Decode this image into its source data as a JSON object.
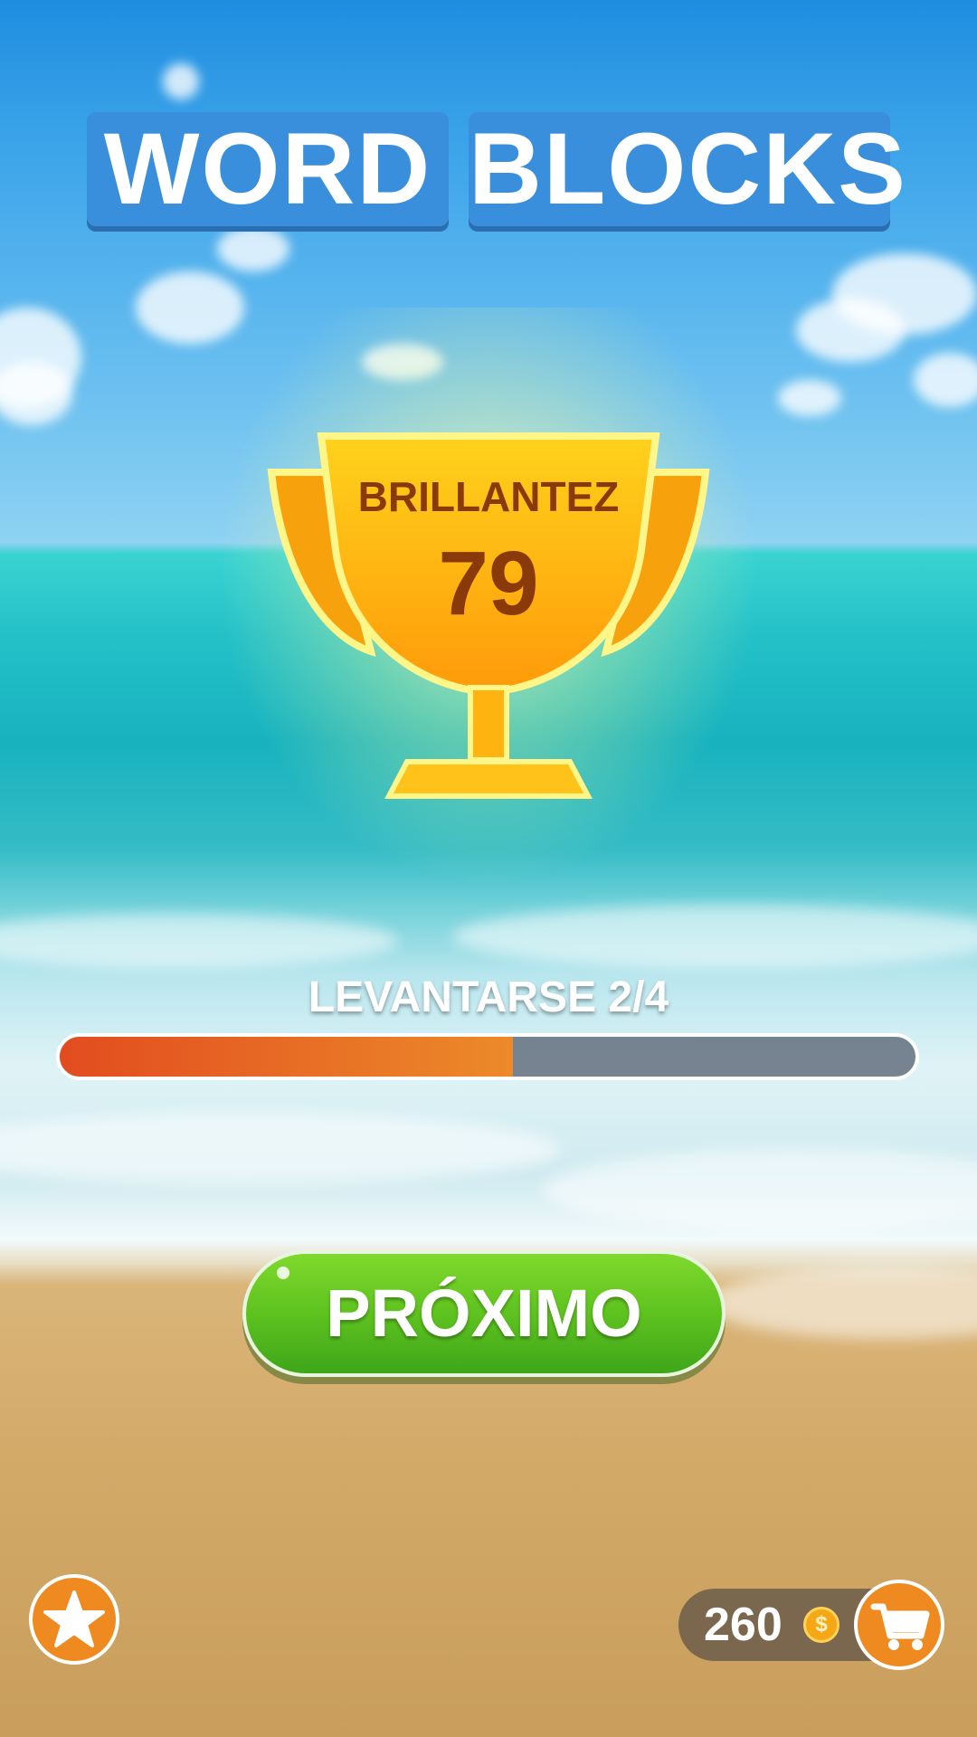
{
  "header": {
    "title_word1": "WORD",
    "title_word2": "BLOCKS"
  },
  "trophy": {
    "label": "BRILLANTEZ",
    "score": "79"
  },
  "progress": {
    "label": "LEVANTARSE 2/4",
    "fraction": 0.53,
    "fill_color": "#e24c1f"
  },
  "actions": {
    "next_label": "PRÓXIMO"
  },
  "footer": {
    "coins": "260",
    "coin_symbol": "$",
    "star_icon": "star-icon",
    "cart_icon": "cart-icon"
  },
  "colors": {
    "accent": "#ee8a1f",
    "button_green": "#5ec21f",
    "title_blue": "#3a8fdc"
  }
}
